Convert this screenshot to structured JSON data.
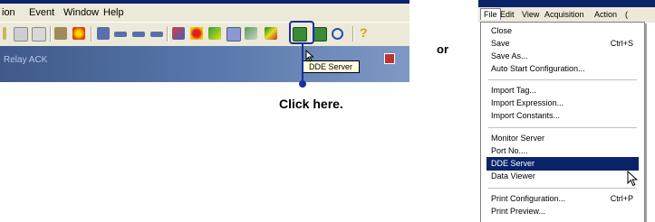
{
  "left_window": {
    "menu": [
      "ion",
      "Event",
      "Window",
      "Help"
    ],
    "status_text": "Relay ACK",
    "tooltip": "DDE Server",
    "icons": [
      "paste-icon",
      "copy-icon",
      "tag-icon",
      "star-icon",
      "square-icon",
      "bar-icon",
      "bar2-icon",
      "chart-icon",
      "bug-icon",
      "graph-icon",
      "grid-icon",
      "chart2-icon",
      "chart3-icon",
      "dde-server-icon",
      "data-viewer-icon",
      "zoom-icon",
      "help-icon"
    ]
  },
  "callout": {
    "label": "Click here."
  },
  "or_label": "or",
  "right_window": {
    "menubar": [
      "File",
      "Edit",
      "View",
      "Acquisition",
      "Action",
      "("
    ],
    "menu_items": [
      {
        "label": "Close",
        "shortcut": ""
      },
      {
        "label": "Save",
        "shortcut": "Ctrl+S"
      },
      {
        "label": "Save As...",
        "shortcut": ""
      },
      {
        "label": "Auto Start Configuration...",
        "shortcut": ""
      },
      {
        "label": "Import Tag...",
        "shortcut": ""
      },
      {
        "label": "Import Expression...",
        "shortcut": ""
      },
      {
        "label": "Import Constants...",
        "shortcut": ""
      },
      {
        "label": "Monitor Server",
        "shortcut": ""
      },
      {
        "label": "Port No....",
        "shortcut": ""
      },
      {
        "label": "DDE Server",
        "shortcut": ""
      },
      {
        "label": "Data Viewer",
        "shortcut": ""
      },
      {
        "label": "Print Configuration...",
        "shortcut": "Ctrl+P"
      },
      {
        "label": "Print Preview...",
        "shortcut": ""
      }
    ],
    "selected_item": "DDE Server"
  }
}
